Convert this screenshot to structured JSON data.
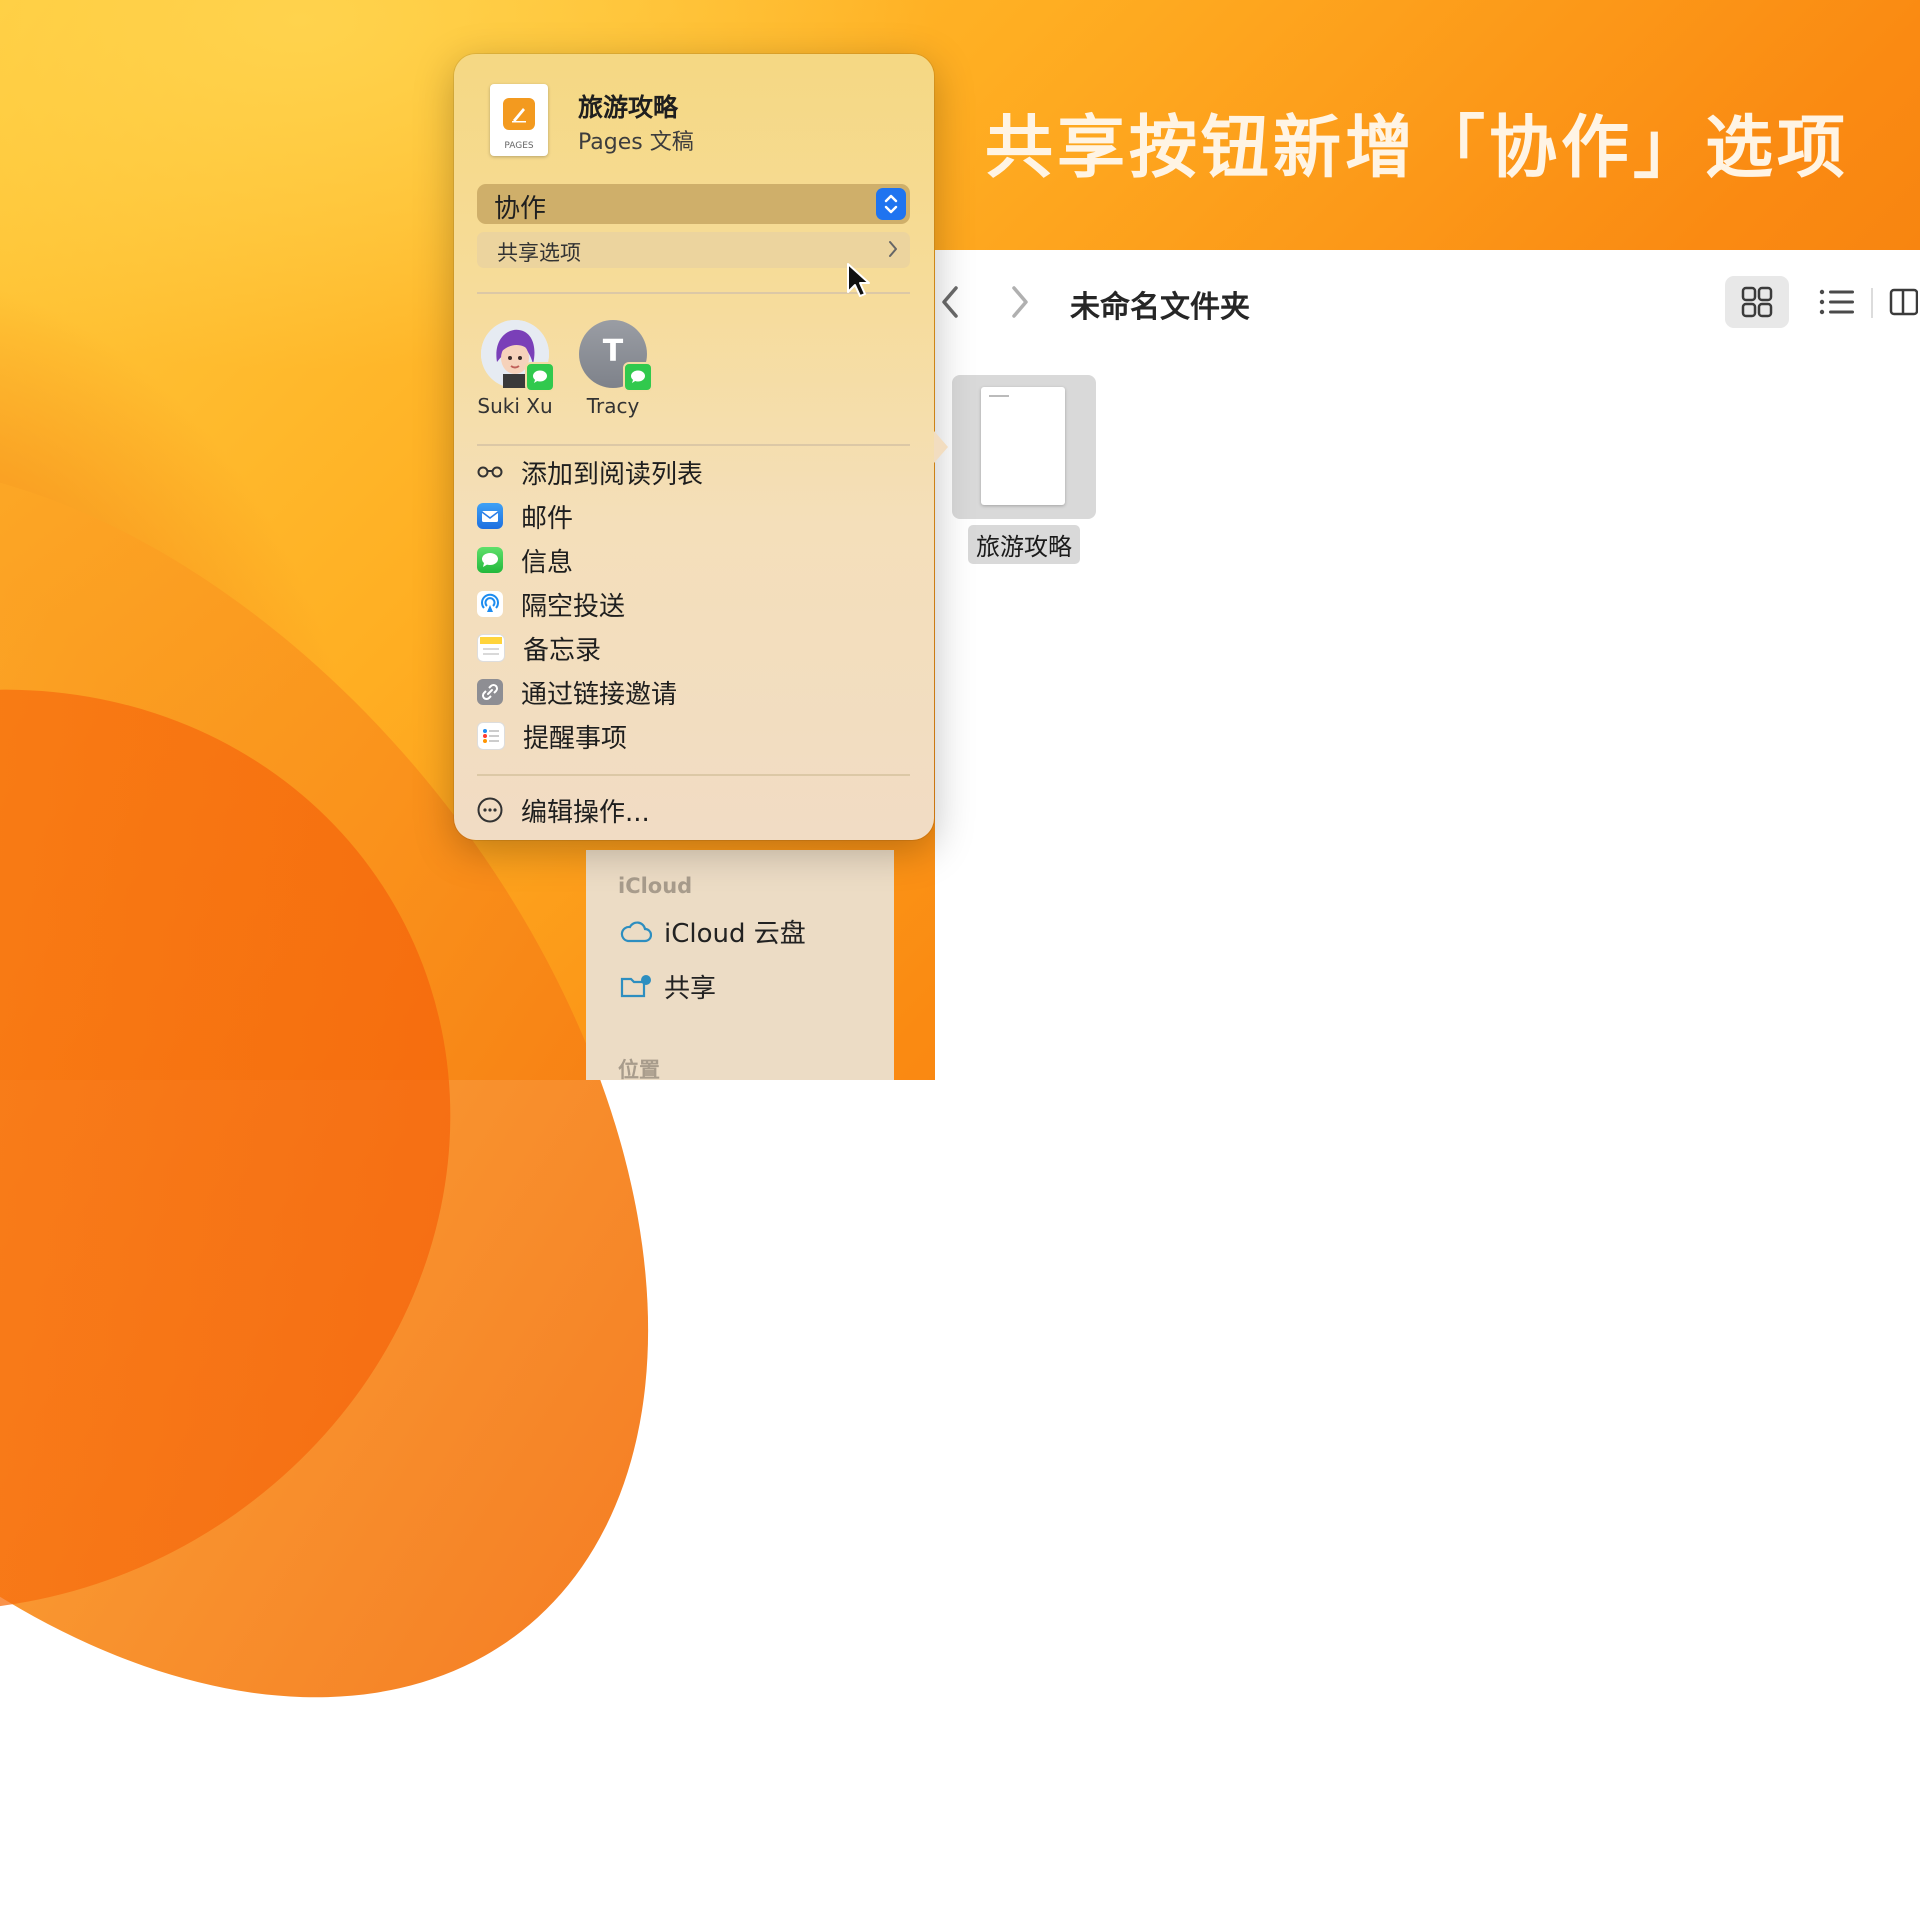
{
  "headline": "共享按钮新增「协作」选项",
  "finder": {
    "folder_title": "未命名文件夹",
    "file_name": "旅游攻略",
    "sidebar": {
      "section_icloud": "iCloud",
      "item_icloud_drive": "iCloud 云盘",
      "item_shared": "共享",
      "section_locations": "位置"
    }
  },
  "share_popover": {
    "doc_title": "旅游攻略",
    "doc_subtitle": "Pages 文稿",
    "doc_icon_label": "PAGES",
    "collab_select": "协作",
    "share_options": "共享选项",
    "people": [
      {
        "name": "Suki Xu",
        "initial": ""
      },
      {
        "name": "Tracy",
        "initial": "T"
      }
    ],
    "actions": [
      {
        "label": "添加到阅读列表",
        "icon": "reading-list-icon"
      },
      {
        "label": "邮件",
        "icon": "mail-icon"
      },
      {
        "label": "信息",
        "icon": "messages-icon"
      },
      {
        "label": "隔空投送",
        "icon": "airdrop-icon"
      },
      {
        "label": "备忘录",
        "icon": "notes-icon"
      },
      {
        "label": "通过链接邀请",
        "icon": "link-icon"
      },
      {
        "label": "提醒事项",
        "icon": "reminders-icon"
      }
    ],
    "edit_actions": "编辑操作..."
  },
  "colors": {
    "accent_blue": "#1f74f0",
    "messages_green": "#31c94d",
    "wallpaper_orange": "#f7941d"
  }
}
